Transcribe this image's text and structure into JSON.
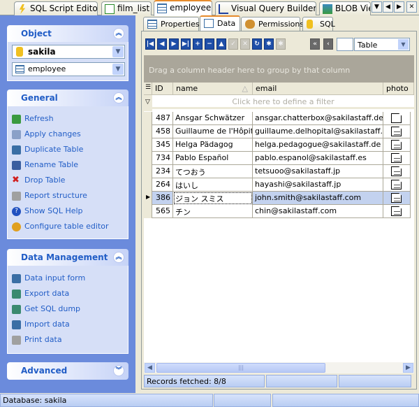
{
  "tabs": [
    {
      "label": "SQL Script Editor",
      "icon": "lightning-db-icon"
    },
    {
      "label": "film_list",
      "icon": "view-icon"
    },
    {
      "label": "employee",
      "icon": "table-icon",
      "active": true
    },
    {
      "label": "Visual Query Builder",
      "icon": "query-builder-icon"
    },
    {
      "label": "BLOB Viewer",
      "icon": "image-icon"
    }
  ],
  "tab_nav": {
    "menu": "▼",
    "prev": "◀",
    "next": "▶",
    "close": "✕"
  },
  "sidebar": {
    "object": {
      "title": "Object",
      "database": "sakila",
      "table": "employee"
    },
    "general": {
      "title": "General",
      "items": [
        "Refresh",
        "Apply changes",
        "Duplicate Table",
        "Rename Table",
        "Drop Table",
        "Report structure",
        "Show SQL Help",
        "Configure table editor"
      ]
    },
    "data_management": {
      "title": "Data Management",
      "items": [
        "Data input form",
        "Export data",
        "Get SQL dump",
        "Import data",
        "Print data"
      ]
    },
    "advanced": {
      "title": "Advanced"
    }
  },
  "subtabs": [
    {
      "label": "Properties"
    },
    {
      "label": "Data",
      "active": true
    },
    {
      "label": "Permissions"
    },
    {
      "label": "SQL"
    }
  ],
  "toolbar": {
    "view_mode": "Table"
  },
  "grid": {
    "group_hint": "Drag a column header here to group by that column",
    "filter_hint": "Click here to define a filter",
    "columns": [
      "ID",
      "name",
      "email",
      "photo"
    ],
    "sort": {
      "column": "name",
      "direction": "ascending"
    },
    "rows": [
      {
        "id": "487",
        "name": "Ansgar Schwätzer",
        "email": "ansgar.chatterbox@sakilastaff.de",
        "photo": "empty"
      },
      {
        "id": "458",
        "name": "Guillaume de l'Hôpital",
        "email": "guillaume.delhopital@sakilastaff.es",
        "photo": "data"
      },
      {
        "id": "345",
        "name": "Helga Pädagog",
        "email": "helga.pedagogue@sakilastaff.de",
        "photo": "data"
      },
      {
        "id": "734",
        "name": "Pablo Español",
        "email": "pablo.espanol@sakilastaff.es",
        "photo": "data"
      },
      {
        "id": "234",
        "name": "てつおう",
        "email": "tetsuoo@sakilastaff.jp",
        "photo": "data"
      },
      {
        "id": "264",
        "name": "はいし",
        "email": "hayashi@sakilastaff.jp",
        "photo": "data"
      },
      {
        "id": "386",
        "name": "ジョン スミス",
        "email": "john.smith@sakilastaff.com",
        "photo": "data",
        "selected": true
      },
      {
        "id": "565",
        "name": "チン",
        "email": "chin@sakilastaff.com",
        "photo": "data"
      }
    ]
  },
  "records_status": "Records fetched: 8/8",
  "statusbar": {
    "database": "Database: sakila"
  },
  "colors": {
    "sidebar": "#6b8bdc",
    "selection": "#c3d2ef",
    "accent": "#215dc6"
  }
}
